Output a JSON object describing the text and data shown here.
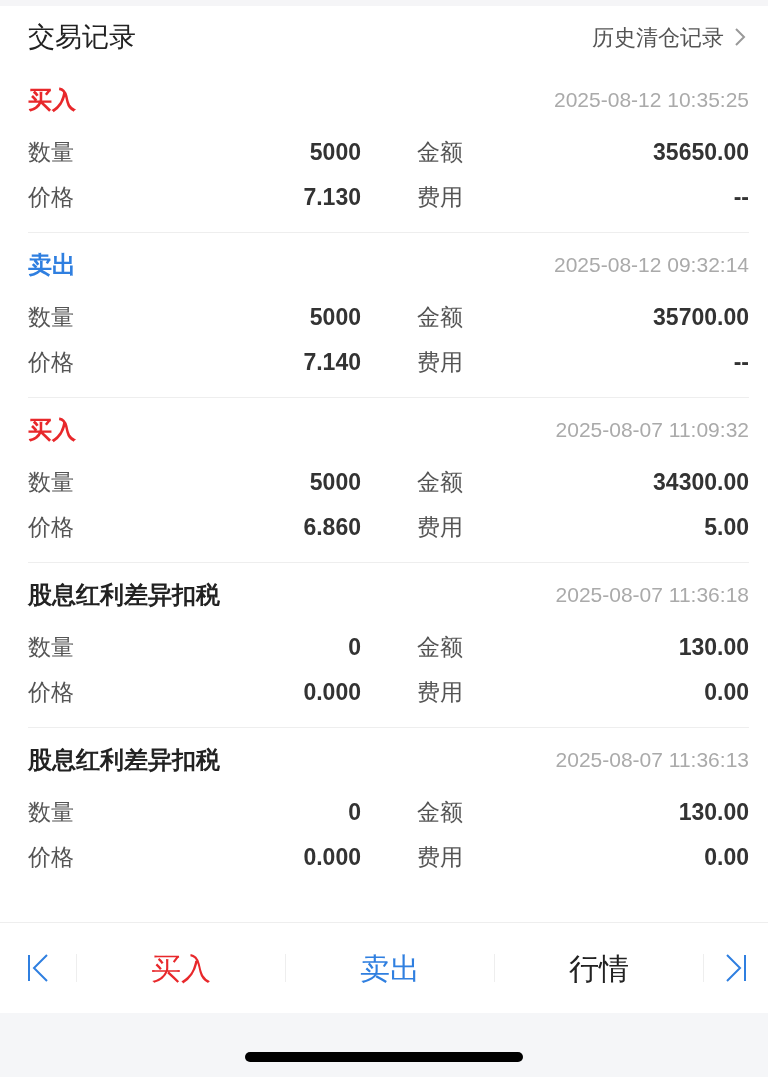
{
  "header": {
    "title": "交易记录",
    "link": "历史清仓记录"
  },
  "records": [
    {
      "kind": "buy",
      "type": "买入",
      "time": "2025-08-12 10:35:25",
      "quantity_label": "数量",
      "quantity": "5000",
      "amount_label": "金额",
      "amount": "35650.00",
      "price_label": "价格",
      "price": "7.130",
      "fee_label": "费用",
      "fee": "--"
    },
    {
      "kind": "sell",
      "type": "卖出",
      "time": "2025-08-12 09:32:14",
      "quantity_label": "数量",
      "quantity": "5000",
      "amount_label": "金额",
      "amount": "35700.00",
      "price_label": "价格",
      "price": "7.140",
      "fee_label": "费用",
      "fee": "--"
    },
    {
      "kind": "buy",
      "type": "买入",
      "time": "2025-08-07 11:09:32",
      "quantity_label": "数量",
      "quantity": "5000",
      "amount_label": "金额",
      "amount": "34300.00",
      "price_label": "价格",
      "price": "6.860",
      "fee_label": "费用",
      "fee": "5.00"
    },
    {
      "kind": "other",
      "type": "股息红利差异扣税",
      "time": "2025-08-07 11:36:18",
      "quantity_label": "数量",
      "quantity": "0",
      "amount_label": "金额",
      "amount": "130.00",
      "price_label": "价格",
      "price": "0.000",
      "fee_label": "费用",
      "fee": "0.00"
    },
    {
      "kind": "other",
      "type": "股息红利差异扣税",
      "time": "2025-08-07 11:36:13",
      "quantity_label": "数量",
      "quantity": "0",
      "amount_label": "金额",
      "amount": "130.00",
      "price_label": "价格",
      "price": "0.000",
      "fee_label": "费用",
      "fee": "0.00"
    }
  ],
  "bottom_bar": [
    {
      "kind": "buy",
      "label": "买入"
    },
    {
      "kind": "sell",
      "label": "卖出"
    },
    {
      "kind": "quote",
      "label": "行情"
    }
  ]
}
